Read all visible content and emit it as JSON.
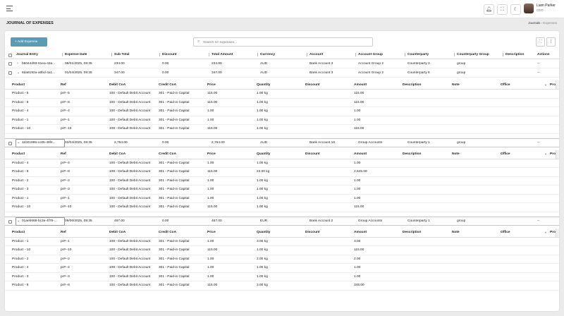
{
  "topbar": {
    "user_name": "Liam Parker",
    "user_role": "CEO",
    "icons": [
      "bell-icon",
      "fullscreen-icon",
      "moon-icon"
    ]
  },
  "page": {
    "title": "JOURNAL OF EXPENSES",
    "breadcrumb": [
      "Journals",
      "Expenses"
    ]
  },
  "toolbar": {
    "add_label": "+ Add Expense",
    "search_placeholder": "Search for expenses...",
    "more_label": "⋮"
  },
  "table": {
    "headers": [
      "Journal Entry",
      "Expense Date",
      "Sub Total",
      "Discount",
      "Total Amount",
      "Currency",
      "Account",
      "Account Group",
      "Counterparty",
      "Counterparty Group",
      "Description",
      "Actions"
    ],
    "sub_headers": [
      "Product",
      "Ref",
      "Debit CoA",
      "Credit CoA",
      "Price",
      "Quantity",
      "Discount",
      "Amount",
      "Description",
      "Note",
      "Office",
      "Proj"
    ],
    "entries": [
      {
        "id": "b5044d93-61ea-43a...",
        "date": "08/01/2025, 09:35",
        "subtotal": "234.00",
        "discount": "0.00",
        "total": "234.00",
        "currency": "AUD",
        "account": "Bank Account 3",
        "group": "Account Group 2",
        "counterparty": "Counterparty 3",
        "cgroup": "group",
        "desc": "",
        "actions": "--",
        "caret": "›",
        "items": []
      },
      {
        "id": "6da6192a-a0bd-4a1...",
        "date": "01/04/2025, 09:35",
        "subtotal": "347.00",
        "discount": "0.00",
        "total": "347.00",
        "currency": "AUD",
        "account": "Bank Account 3",
        "group": "Account Group 2",
        "counterparty": "Counterparty 6",
        "cgroup": "group",
        "desc": "",
        "actions": "--",
        "caret": "⌄",
        "items": [
          [
            "Product - 5",
            "pr#--5",
            "100 - Default Debit Account",
            "301 - Paid-in Capital",
            "115.00",
            "1.00 kg",
            "",
            "115.00",
            "",
            "",
            ""
          ],
          [
            "Product - 8",
            "pr#--8",
            "100 - Default Debit Account",
            "301 - Paid-in Capital",
            "115.00",
            "1.00 kg",
            "",
            "115.00",
            "",
            "",
            ""
          ],
          [
            "Product - 4",
            "pr#--4",
            "100 - Default Debit Account",
            "301 - Paid-in Capital",
            "1.00",
            "1.00 kg",
            "",
            "1.00",
            "",
            "",
            ""
          ],
          [
            "Product - 1",
            "pr#--1",
            "100 - Default Debit Account",
            "301 - Paid-in Capital",
            "1.00",
            "1.00 kg",
            "",
            "1.00",
            "",
            "",
            ""
          ],
          [
            "Product - 10",
            "pr#--10",
            "100 - Default Debit Account",
            "301 - Paid-in Capital",
            "115.00",
            "1.00 kg",
            "",
            "115.00",
            "",
            "",
            ""
          ]
        ]
      },
      {
        "id": "11b01995-cc05-49f4...",
        "date": "02/04/2025, 09:35",
        "subtotal": "2,764.00",
        "discount": "0.00",
        "total": "2,764.00",
        "currency": "AUD",
        "account": "Bank Account 10",
        "group": "Group Accounts",
        "counterparty": "Counterparty 1",
        "cgroup": "group",
        "desc": "",
        "actions": "--",
        "caret": "⌄",
        "items": [
          [
            "Product - 4",
            "pr#--4",
            "100 - Default Debit Account",
            "301 - Paid-in Capital",
            "1.00",
            "1.00 kg",
            "",
            "1.00",
            "",
            "",
            ""
          ],
          [
            "Product - 8",
            "pr#--8",
            "100 - Default Debit Account",
            "301 - Paid-in Capital",
            "115.00",
            "23.00 kg",
            "",
            "2,645.00",
            "",
            "",
            ""
          ],
          [
            "Product - 2",
            "pr#--2",
            "100 - Default Debit Account",
            "301 - Paid-in Capital",
            "1.00",
            "1.00 kg",
            "",
            "1.00",
            "",
            "",
            ""
          ],
          [
            "Product - 3",
            "pr#--3",
            "100 - Default Debit Account",
            "301 - Paid-in Capital",
            "1.00",
            "1.00 kg",
            "",
            "1.00",
            "",
            "",
            ""
          ],
          [
            "Product - 1",
            "pr#--1",
            "100 - Default Debit Account",
            "301 - Paid-in Capital",
            "1.00",
            "1.00 kg",
            "",
            "1.00",
            "",
            "",
            ""
          ],
          [
            "Product - 10",
            "pr#--10",
            "100 - Default Debit Account",
            "301 - Paid-in Capital",
            "115.00",
            "1.00 kg",
            "",
            "115.00",
            "",
            "",
            ""
          ]
        ]
      },
      {
        "id": "01aeb668-bc3a-4f76-...",
        "date": "09/06/2025, 09:35",
        "subtotal": "467.00",
        "discount": "0.00",
        "total": "467.00",
        "currency": "EUR",
        "account": "Bank Account 2",
        "group": "Group Accounts",
        "counterparty": "Counterparty 1",
        "cgroup": "group",
        "desc": "",
        "actions": "--",
        "caret": "⌄",
        "items": [
          [
            "Product - 1",
            "pr#--1",
            "100 - Default Debit Account",
            "301 - Paid-in Capital",
            "1.00",
            "3.00 kg",
            "",
            "3.00",
            "",
            "",
            ""
          ],
          [
            "Product - 10",
            "pr#--10",
            "100 - Default Debit Account",
            "301 - Paid-in Capital",
            "115.00",
            "1.00 kg",
            "",
            "115.00",
            "",
            "",
            ""
          ],
          [
            "Product - 2",
            "pr#--2",
            "100 - Default Debit Account",
            "301 - Paid-in Capital",
            "1.00",
            "2.00 kg",
            "",
            "2.00",
            "",
            "",
            ""
          ],
          [
            "Product - 4",
            "pr#--4",
            "100 - Default Debit Account",
            "301 - Paid-in Capital",
            "1.00",
            "1.00 kg",
            "",
            "1.00",
            "",
            "",
            ""
          ],
          [
            "Product - 3",
            "pr#--3",
            "100 - Default Debit Account",
            "301 - Paid-in Capital",
            "1.00",
            "1.00 kg",
            "",
            "1.00",
            "",
            "",
            ""
          ],
          [
            "Product - 8",
            "pr#--8",
            "100 - Default Debit Account",
            "301 - Paid-in Capital",
            "115.00",
            "3.00 kg",
            "",
            "345.00",
            "",
            "",
            ""
          ]
        ]
      }
    ]
  },
  "colors": {
    "accent": "#5a9bb5",
    "background": "#ebebeb"
  }
}
